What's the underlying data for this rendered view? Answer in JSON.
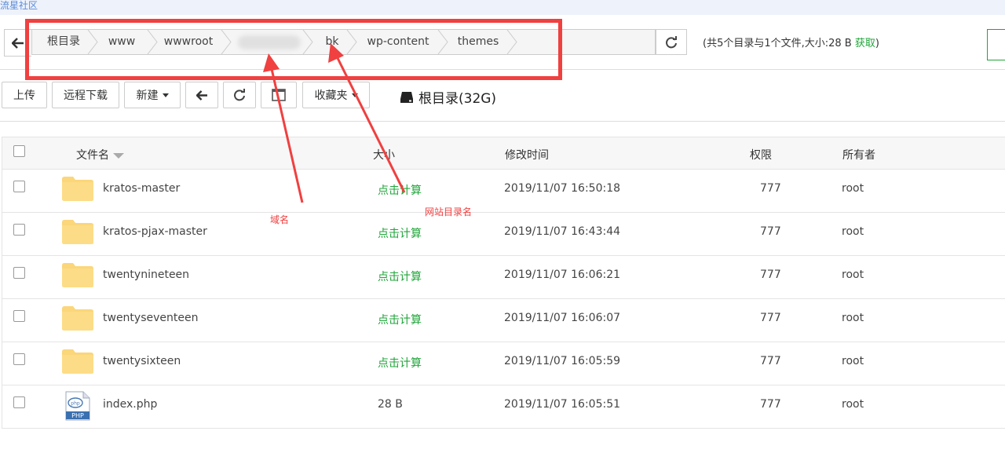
{
  "top_link": "流星社区",
  "breadcrumb": {
    "items": [
      "根目录",
      "www",
      "wwwroot",
      "bk",
      "wp-content",
      "themes"
    ]
  },
  "summary": {
    "text": "(共5个目录与1个文件,大小:28 B",
    "get_link": "获取",
    "close": ")"
  },
  "toolbar": {
    "upload": "上传",
    "remote_download": "远程下载",
    "new": "新建",
    "favorites": "收藏夹",
    "disk": "根目录(32G)"
  },
  "table": {
    "headers": {
      "name": "文件名",
      "size": "大小",
      "mtime": "修改时间",
      "perm": "权限",
      "owner": "所有者"
    },
    "rows": [
      {
        "name": "kratos-master",
        "size": "点击计算",
        "mtime": "2019/11/07 16:50:18",
        "perm": "777",
        "owner": "root",
        "icon": "folder-icon"
      },
      {
        "name": "kratos-pjax-master",
        "size": "点击计算",
        "mtime": "2019/11/07 16:43:44",
        "perm": "777",
        "owner": "root",
        "icon": "folder-icon"
      },
      {
        "name": "twentynineteen",
        "size": "点击计算",
        "mtime": "2019/11/07 16:06:21",
        "perm": "777",
        "owner": "root",
        "icon": "folder-icon"
      },
      {
        "name": "twentyseventeen",
        "size": "点击计算",
        "mtime": "2019/11/07 16:06:07",
        "perm": "777",
        "owner": "root",
        "icon": "folder-icon"
      },
      {
        "name": "twentysixteen",
        "size": "点击计算",
        "mtime": "2019/11/07 16:05:59",
        "perm": "777",
        "owner": "root",
        "icon": "folder-icon"
      },
      {
        "name": "index.php",
        "size": "28 B",
        "mtime": "2019/11/07 16:05:51",
        "perm": "777",
        "owner": "root",
        "icon": "php-file-icon"
      }
    ]
  },
  "annotations": {
    "domain_label": "域名",
    "site_dir_label": "网站目录名"
  },
  "colors": {
    "accent_green": "#20a53a",
    "annotation_red": "#f04040"
  }
}
